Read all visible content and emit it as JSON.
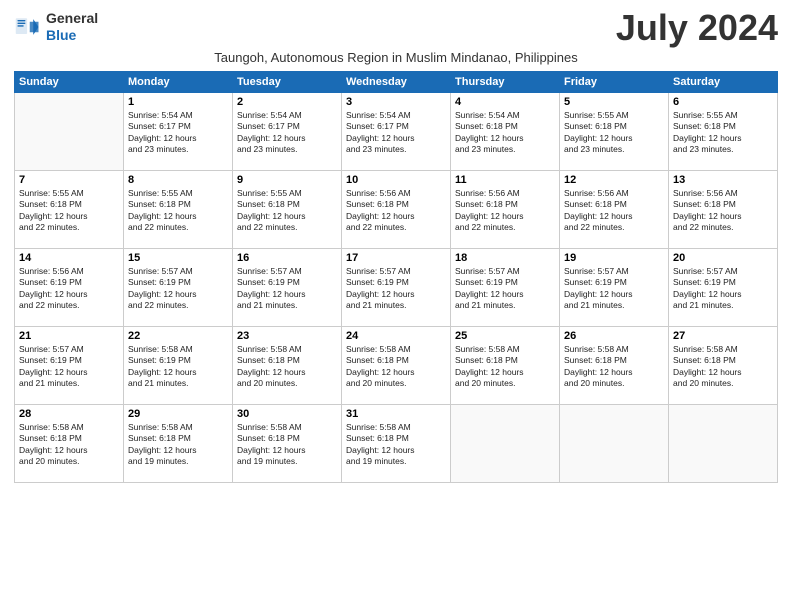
{
  "logo": {
    "line1": "General",
    "line2": "Blue"
  },
  "title": "July 2024",
  "location": "Taungoh, Autonomous Region in Muslim Mindanao, Philippines",
  "header_days": [
    "Sunday",
    "Monday",
    "Tuesday",
    "Wednesday",
    "Thursday",
    "Friday",
    "Saturday"
  ],
  "weeks": [
    [
      {
        "day": "",
        "info": ""
      },
      {
        "day": "1",
        "info": "Sunrise: 5:54 AM\nSunset: 6:17 PM\nDaylight: 12 hours\nand 23 minutes."
      },
      {
        "day": "2",
        "info": "Sunrise: 5:54 AM\nSunset: 6:17 PM\nDaylight: 12 hours\nand 23 minutes."
      },
      {
        "day": "3",
        "info": "Sunrise: 5:54 AM\nSunset: 6:17 PM\nDaylight: 12 hours\nand 23 minutes."
      },
      {
        "day": "4",
        "info": "Sunrise: 5:54 AM\nSunset: 6:18 PM\nDaylight: 12 hours\nand 23 minutes."
      },
      {
        "day": "5",
        "info": "Sunrise: 5:55 AM\nSunset: 6:18 PM\nDaylight: 12 hours\nand 23 minutes."
      },
      {
        "day": "6",
        "info": "Sunrise: 5:55 AM\nSunset: 6:18 PM\nDaylight: 12 hours\nand 23 minutes."
      }
    ],
    [
      {
        "day": "7",
        "info": "Sunrise: 5:55 AM\nSunset: 6:18 PM\nDaylight: 12 hours\nand 22 minutes."
      },
      {
        "day": "8",
        "info": "Sunrise: 5:55 AM\nSunset: 6:18 PM\nDaylight: 12 hours\nand 22 minutes."
      },
      {
        "day": "9",
        "info": "Sunrise: 5:55 AM\nSunset: 6:18 PM\nDaylight: 12 hours\nand 22 minutes."
      },
      {
        "day": "10",
        "info": "Sunrise: 5:56 AM\nSunset: 6:18 PM\nDaylight: 12 hours\nand 22 minutes."
      },
      {
        "day": "11",
        "info": "Sunrise: 5:56 AM\nSunset: 6:18 PM\nDaylight: 12 hours\nand 22 minutes."
      },
      {
        "day": "12",
        "info": "Sunrise: 5:56 AM\nSunset: 6:18 PM\nDaylight: 12 hours\nand 22 minutes."
      },
      {
        "day": "13",
        "info": "Sunrise: 5:56 AM\nSunset: 6:18 PM\nDaylight: 12 hours\nand 22 minutes."
      }
    ],
    [
      {
        "day": "14",
        "info": "Sunrise: 5:56 AM\nSunset: 6:19 PM\nDaylight: 12 hours\nand 22 minutes."
      },
      {
        "day": "15",
        "info": "Sunrise: 5:57 AM\nSunset: 6:19 PM\nDaylight: 12 hours\nand 22 minutes."
      },
      {
        "day": "16",
        "info": "Sunrise: 5:57 AM\nSunset: 6:19 PM\nDaylight: 12 hours\nand 21 minutes."
      },
      {
        "day": "17",
        "info": "Sunrise: 5:57 AM\nSunset: 6:19 PM\nDaylight: 12 hours\nand 21 minutes."
      },
      {
        "day": "18",
        "info": "Sunrise: 5:57 AM\nSunset: 6:19 PM\nDaylight: 12 hours\nand 21 minutes."
      },
      {
        "day": "19",
        "info": "Sunrise: 5:57 AM\nSunset: 6:19 PM\nDaylight: 12 hours\nand 21 minutes."
      },
      {
        "day": "20",
        "info": "Sunrise: 5:57 AM\nSunset: 6:19 PM\nDaylight: 12 hours\nand 21 minutes."
      }
    ],
    [
      {
        "day": "21",
        "info": "Sunrise: 5:57 AM\nSunset: 6:19 PM\nDaylight: 12 hours\nand 21 minutes."
      },
      {
        "day": "22",
        "info": "Sunrise: 5:58 AM\nSunset: 6:19 PM\nDaylight: 12 hours\nand 21 minutes."
      },
      {
        "day": "23",
        "info": "Sunrise: 5:58 AM\nSunset: 6:18 PM\nDaylight: 12 hours\nand 20 minutes."
      },
      {
        "day": "24",
        "info": "Sunrise: 5:58 AM\nSunset: 6:18 PM\nDaylight: 12 hours\nand 20 minutes."
      },
      {
        "day": "25",
        "info": "Sunrise: 5:58 AM\nSunset: 6:18 PM\nDaylight: 12 hours\nand 20 minutes."
      },
      {
        "day": "26",
        "info": "Sunrise: 5:58 AM\nSunset: 6:18 PM\nDaylight: 12 hours\nand 20 minutes."
      },
      {
        "day": "27",
        "info": "Sunrise: 5:58 AM\nSunset: 6:18 PM\nDaylight: 12 hours\nand 20 minutes."
      }
    ],
    [
      {
        "day": "28",
        "info": "Sunrise: 5:58 AM\nSunset: 6:18 PM\nDaylight: 12 hours\nand 20 minutes."
      },
      {
        "day": "29",
        "info": "Sunrise: 5:58 AM\nSunset: 6:18 PM\nDaylight: 12 hours\nand 19 minutes."
      },
      {
        "day": "30",
        "info": "Sunrise: 5:58 AM\nSunset: 6:18 PM\nDaylight: 12 hours\nand 19 minutes."
      },
      {
        "day": "31",
        "info": "Sunrise: 5:58 AM\nSunset: 6:18 PM\nDaylight: 12 hours\nand 19 minutes."
      },
      {
        "day": "",
        "info": ""
      },
      {
        "day": "",
        "info": ""
      },
      {
        "day": "",
        "info": ""
      }
    ]
  ]
}
